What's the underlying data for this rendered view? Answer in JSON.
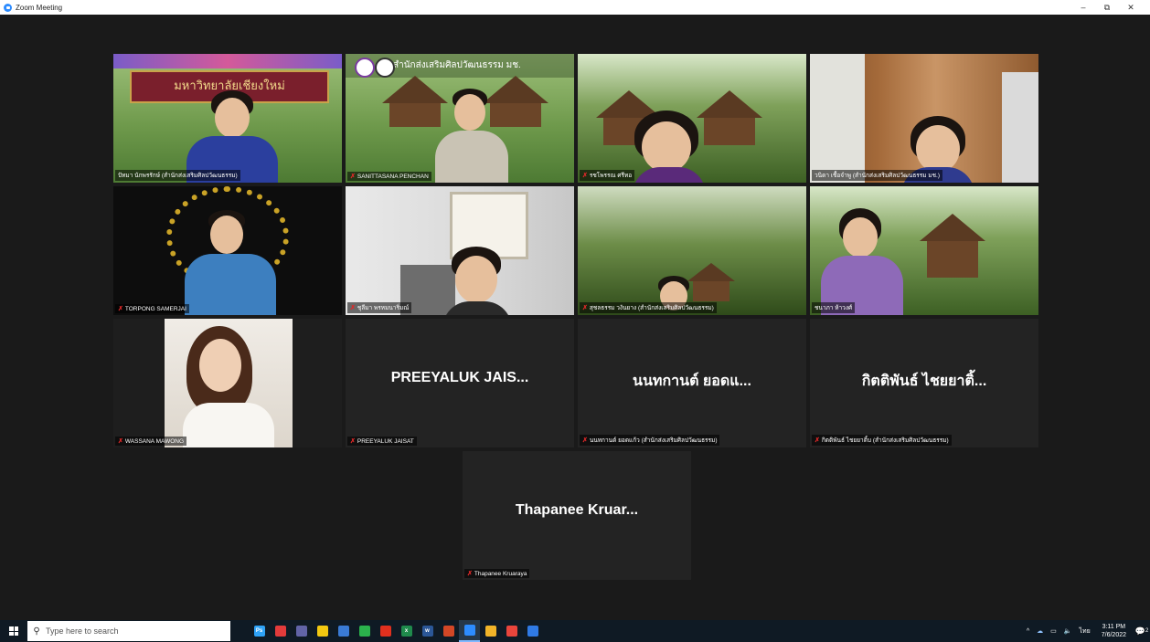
{
  "window": {
    "title": "Zoom Meeting",
    "minimize": "–",
    "restore": "⧉",
    "close": "✕"
  },
  "participants": [
    {
      "name": "ปัทมา  นักพรรักษ์ (สำนักส่งเสริมศิลปวัฒนธรรม)",
      "active": true
    },
    {
      "name": "SANITTASANA PENCHAN",
      "muted": true
    },
    {
      "name": "รชโพรรณ  ศรีทอ",
      "muted": true
    },
    {
      "name": "วนิดา  เชื้อจำพู (สำนักส่งเสริมศิลปวัฒนธรรม มช.)"
    },
    {
      "name": "TORPONG SAMERJAI",
      "muted": true
    },
    {
      "name": "ชุลีมา  พรหมนาริ่มณ์",
      "muted": true
    },
    {
      "name": "สุชลธรรม  วงันยาง (สำนักส่งเสริมศิลปวัฒนธรรม)",
      "muted": true
    },
    {
      "name": "ชนาภา  ห้าวงศ์"
    },
    {
      "name": "WASSANA MAWONG",
      "muted": true
    },
    {
      "name": "PREEYALUK JAISAT",
      "display": "PREEYALUK  JAIS...",
      "muted": true
    },
    {
      "name": "นนทกานต์ ยอดแก้ว (สำนักส่งเสริมศิลปวัฒนธรรม)",
      "display": "นนทกานต์  ยอดแ...",
      "muted": true
    },
    {
      "name": "กิตติพันธ์ ไชยยาติ้บ (สำนักส่งเสริมศิลปวัฒนธรรม)",
      "display": "กิตติพันธ์  ไชยยาติ้...",
      "muted": true
    },
    {
      "name": "Thapanee Kruaraya",
      "display": "Thapanee  Kruar...",
      "muted": true
    }
  ],
  "tile_texts": {
    "sign_mahawitthayalai": "มหาวิทยาลัยเชียงใหม่",
    "sign_banner": "สำนักส่งเสริมศิลปวัฒนธรรม มช."
  },
  "taskbar": {
    "search_placeholder": "Type here to search",
    "apps": [
      {
        "id": "photoshop",
        "label": "Ps",
        "color": "#2fa3f7"
      },
      {
        "id": "app-red",
        "label": "",
        "color": "#e23b3b"
      },
      {
        "id": "teams",
        "label": "",
        "color": "#6264a7"
      },
      {
        "id": "powerbi",
        "label": "",
        "color": "#f2c811"
      },
      {
        "id": "calendar",
        "label": "",
        "color": "#3a7bd5"
      },
      {
        "id": "line",
        "label": "",
        "color": "#2bb24c"
      },
      {
        "id": "acrobat",
        "label": "",
        "color": "#e0301e"
      },
      {
        "id": "excel",
        "label": "x",
        "color": "#1f8a4c"
      },
      {
        "id": "word",
        "label": "w",
        "color": "#2b5797"
      },
      {
        "id": "powerpoint",
        "label": "",
        "color": "#d24726"
      },
      {
        "id": "zoom",
        "label": "",
        "color": "#2d8cff",
        "active": true
      },
      {
        "id": "explorer",
        "label": "",
        "color": "#f0b429"
      },
      {
        "id": "chrome",
        "label": "",
        "color": "#e8453c"
      },
      {
        "id": "snip",
        "label": "",
        "color": "#2f7ae5"
      }
    ],
    "tray_chevron": "^",
    "language": "ไทย",
    "time": "3:11 PM",
    "date": "7/6/2022",
    "notifications": "2"
  }
}
